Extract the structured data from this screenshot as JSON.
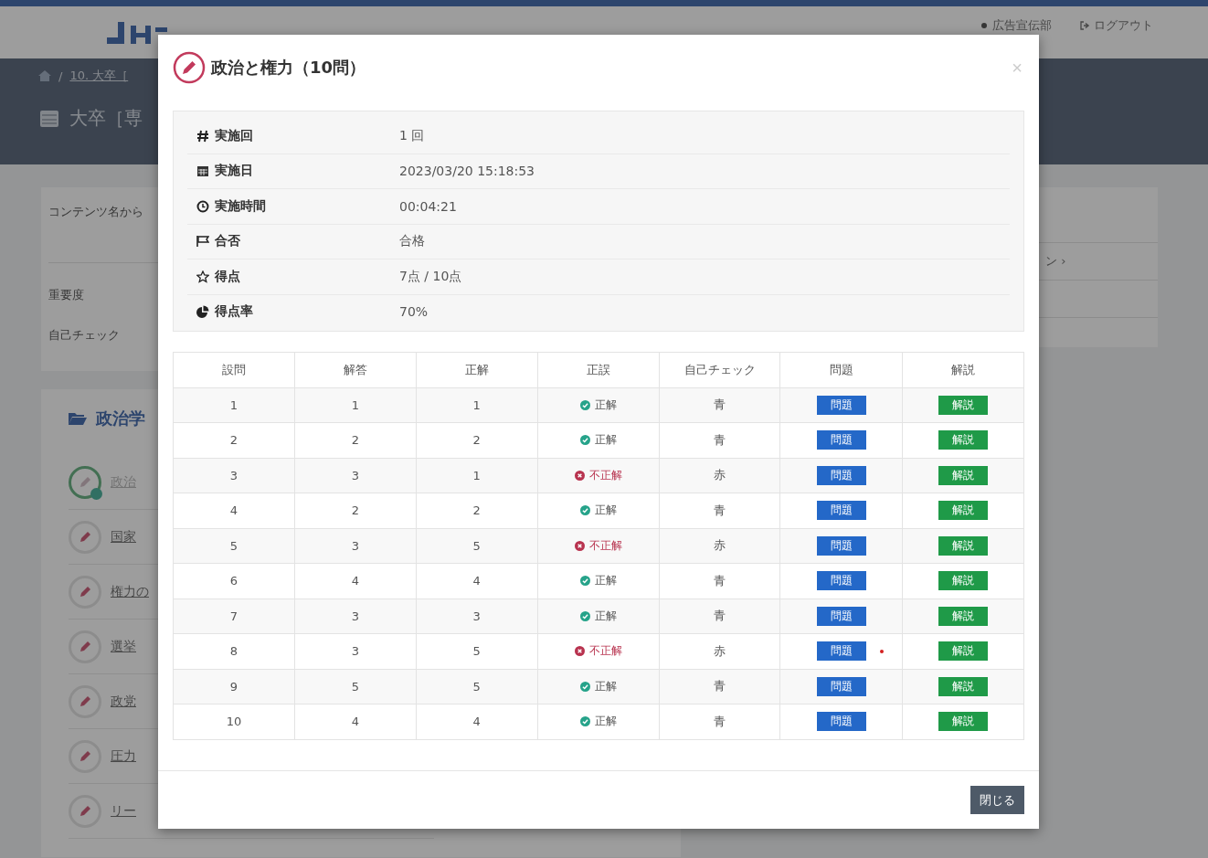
{
  "header": {
    "user": "広告宣伝部",
    "logout": "ログアウト"
  },
  "breadcrumb_separator": "/",
  "breadcrumb": "10. 大卒［",
  "page_title": "大卒［専",
  "filters": [
    "コンテンツ名から",
    "重要度",
    "自己チェック"
  ],
  "right_panel": {
    "link": "ン ›"
  },
  "section": {
    "title": "政治学",
    "items": [
      {
        "label": "政治",
        "completed": true
      },
      {
        "label": "国家",
        "completed": false
      },
      {
        "label": "権力の",
        "completed": false
      },
      {
        "label": "選挙",
        "completed": false
      },
      {
        "label": "政党",
        "completed": false
      },
      {
        "label": "圧力",
        "completed": false
      },
      {
        "label": "リー",
        "completed": false
      }
    ]
  },
  "modal": {
    "title": "政治と権力（10問）",
    "close": "×",
    "info": [
      {
        "kind": "hash",
        "label": "実施回",
        "value": "1 回"
      },
      {
        "kind": "calendar",
        "label": "実施日",
        "value": "2023/03/20 15:18:53"
      },
      {
        "kind": "clock",
        "label": "実施時間",
        "value": "00:04:21"
      },
      {
        "kind": "flag",
        "label": "合否",
        "value": "合格"
      },
      {
        "kind": "star",
        "label": "得点",
        "value": "7点 / 10点"
      },
      {
        "kind": "pie",
        "label": "得点率",
        "value": "70%"
      }
    ],
    "columns": [
      "設問",
      "解答",
      "正解",
      "正誤",
      "自己チェック",
      "問題",
      "解説"
    ],
    "rows": [
      {
        "no": "1",
        "answer": "1",
        "correct": "1",
        "is_correct": true,
        "result": "正解",
        "self_check": "青",
        "marked": false,
        "question": "問題",
        "explanation": "解説"
      },
      {
        "no": "2",
        "answer": "2",
        "correct": "2",
        "is_correct": true,
        "result": "正解",
        "self_check": "青",
        "marked": false,
        "question": "問題",
        "explanation": "解説"
      },
      {
        "no": "3",
        "answer": "3",
        "correct": "1",
        "is_correct": false,
        "result": "不正解",
        "self_check": "赤",
        "marked": false,
        "question": "問題",
        "explanation": "解説"
      },
      {
        "no": "4",
        "answer": "2",
        "correct": "2",
        "is_correct": true,
        "result": "正解",
        "self_check": "青",
        "marked": false,
        "question": "問題",
        "explanation": "解説"
      },
      {
        "no": "5",
        "answer": "3",
        "correct": "5",
        "is_correct": false,
        "result": "不正解",
        "self_check": "赤",
        "marked": false,
        "question": "問題",
        "explanation": "解説"
      },
      {
        "no": "6",
        "answer": "4",
        "correct": "4",
        "is_correct": true,
        "result": "正解",
        "self_check": "青",
        "marked": false,
        "question": "問題",
        "explanation": "解説"
      },
      {
        "no": "7",
        "answer": "3",
        "correct": "3",
        "is_correct": true,
        "result": "正解",
        "self_check": "青",
        "marked": false,
        "question": "問題",
        "explanation": "解説"
      },
      {
        "no": "8",
        "answer": "3",
        "correct": "5",
        "is_correct": false,
        "result": "不正解",
        "self_check": "赤",
        "marked": true,
        "question": "問題",
        "explanation": "解説"
      },
      {
        "no": "9",
        "answer": "5",
        "correct": "5",
        "is_correct": true,
        "result": "正解",
        "self_check": "青",
        "marked": false,
        "question": "問題",
        "explanation": "解説"
      },
      {
        "no": "10",
        "answer": "4",
        "correct": "4",
        "is_correct": true,
        "result": "正解",
        "self_check": "青",
        "marked": false,
        "question": "問題",
        "explanation": "解説"
      }
    ],
    "close_button": "閉じる"
  }
}
